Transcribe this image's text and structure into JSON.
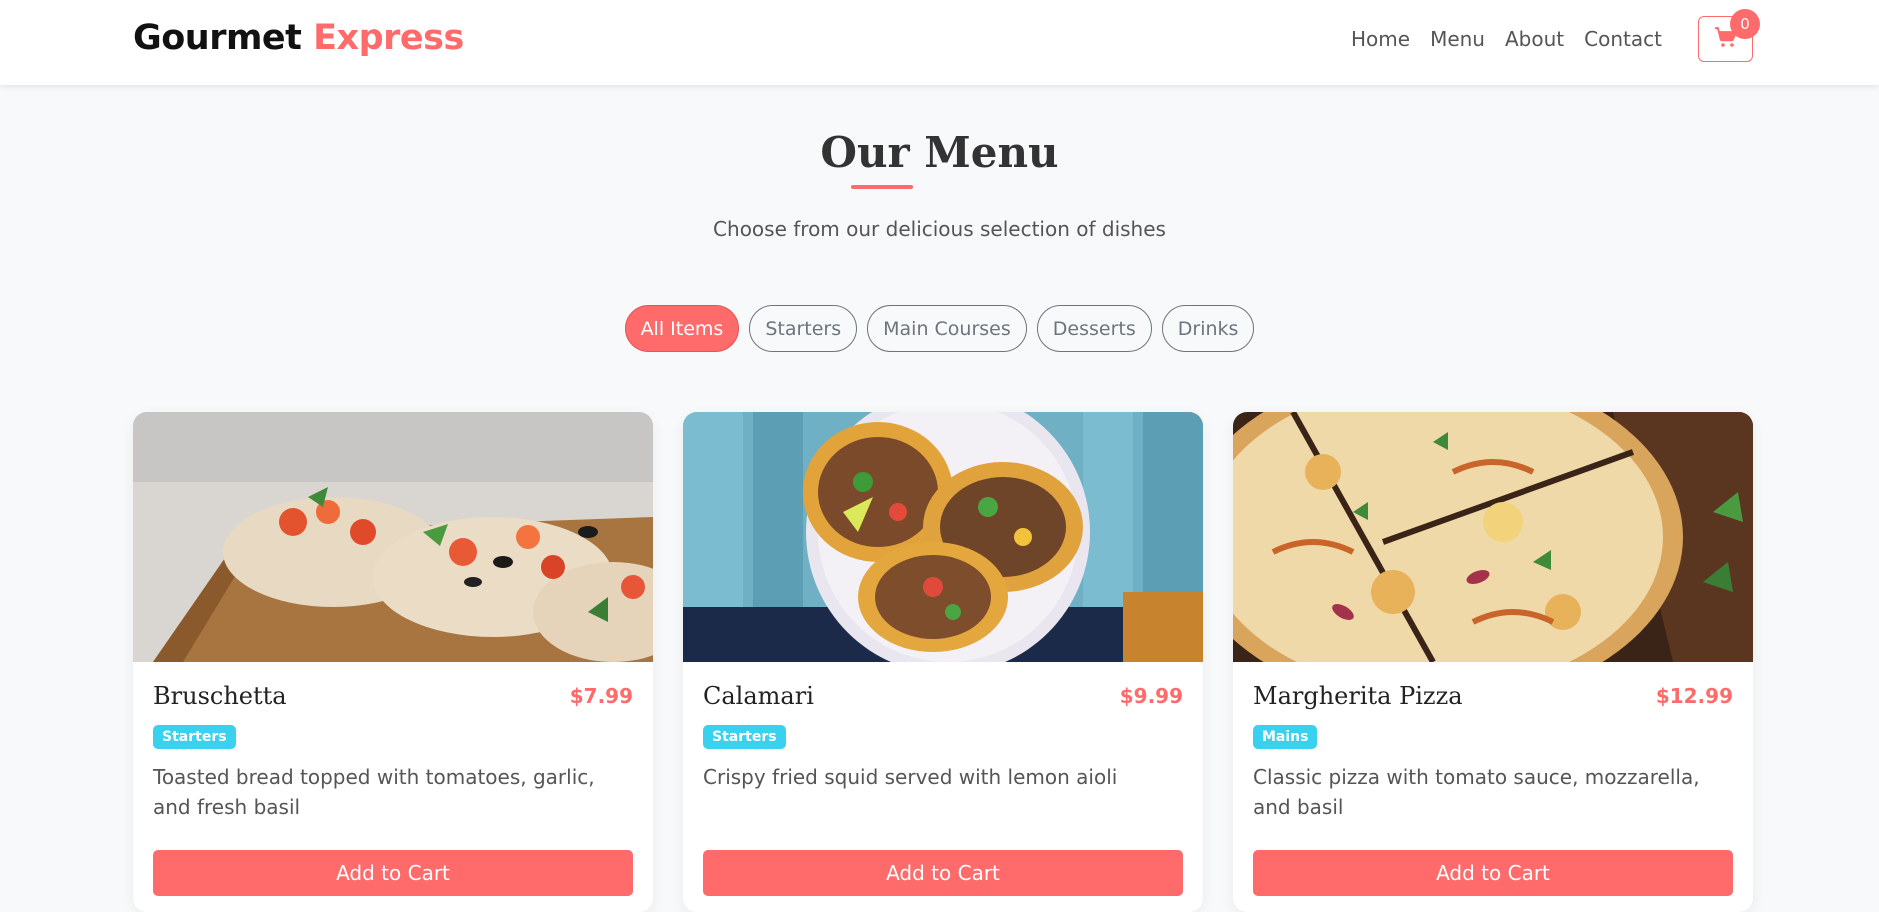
{
  "brand": {
    "name_part1": "Gourmet",
    "name_part2": "Express"
  },
  "nav": {
    "links": [
      "Home",
      "Menu",
      "About",
      "Contact"
    ],
    "cart_count": "0"
  },
  "menu_section": {
    "title": "Our Menu",
    "subtitle": "Choose from our delicious selection of dishes"
  },
  "filters": [
    {
      "label": "All Items",
      "active": true
    },
    {
      "label": "Starters",
      "active": false
    },
    {
      "label": "Main Courses",
      "active": false
    },
    {
      "label": "Desserts",
      "active": false
    },
    {
      "label": "Drinks",
      "active": false
    }
  ],
  "items": [
    {
      "name": "Bruschetta",
      "price": "$7.99",
      "category": "Starters",
      "description": "Toasted bread topped with tomatoes, garlic, and fresh basil",
      "button": "Add to Cart"
    },
    {
      "name": "Calamari",
      "price": "$9.99",
      "category": "Starters",
      "description": "Crispy fried squid served with lemon aioli",
      "button": "Add to Cart"
    },
    {
      "name": "Margherita Pizza",
      "price": "$12.99",
      "category": "Mains",
      "description": "Classic pizza with tomato sauce, mozzarella, and basil",
      "button": "Add to Cart"
    }
  ],
  "colors": {
    "accent": "#ff6b6b",
    "badge": "#3ad1ef",
    "background": "#f8f9fa"
  },
  "icons": {
    "cart": "shopping-cart-icon"
  }
}
